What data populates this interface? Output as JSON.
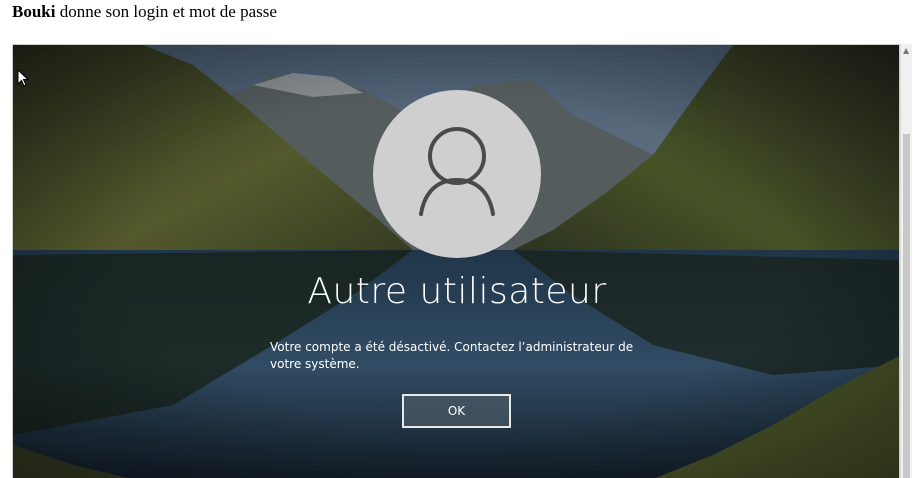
{
  "caption": {
    "bold": "Bouki",
    "rest": " donne son login et mot de passe"
  },
  "lockscreen": {
    "avatar_icon": "user-icon",
    "username": "Autre utilisateur",
    "message": "Votre compte a été désactivé. Contactez l’administrateur de votre système.",
    "ok_label": "OK"
  },
  "colors": {
    "sky": "#7d97ae",
    "mountain": "#3b4426",
    "water": "#1c2c3d",
    "avatar_bg": "#cfcfd0"
  }
}
